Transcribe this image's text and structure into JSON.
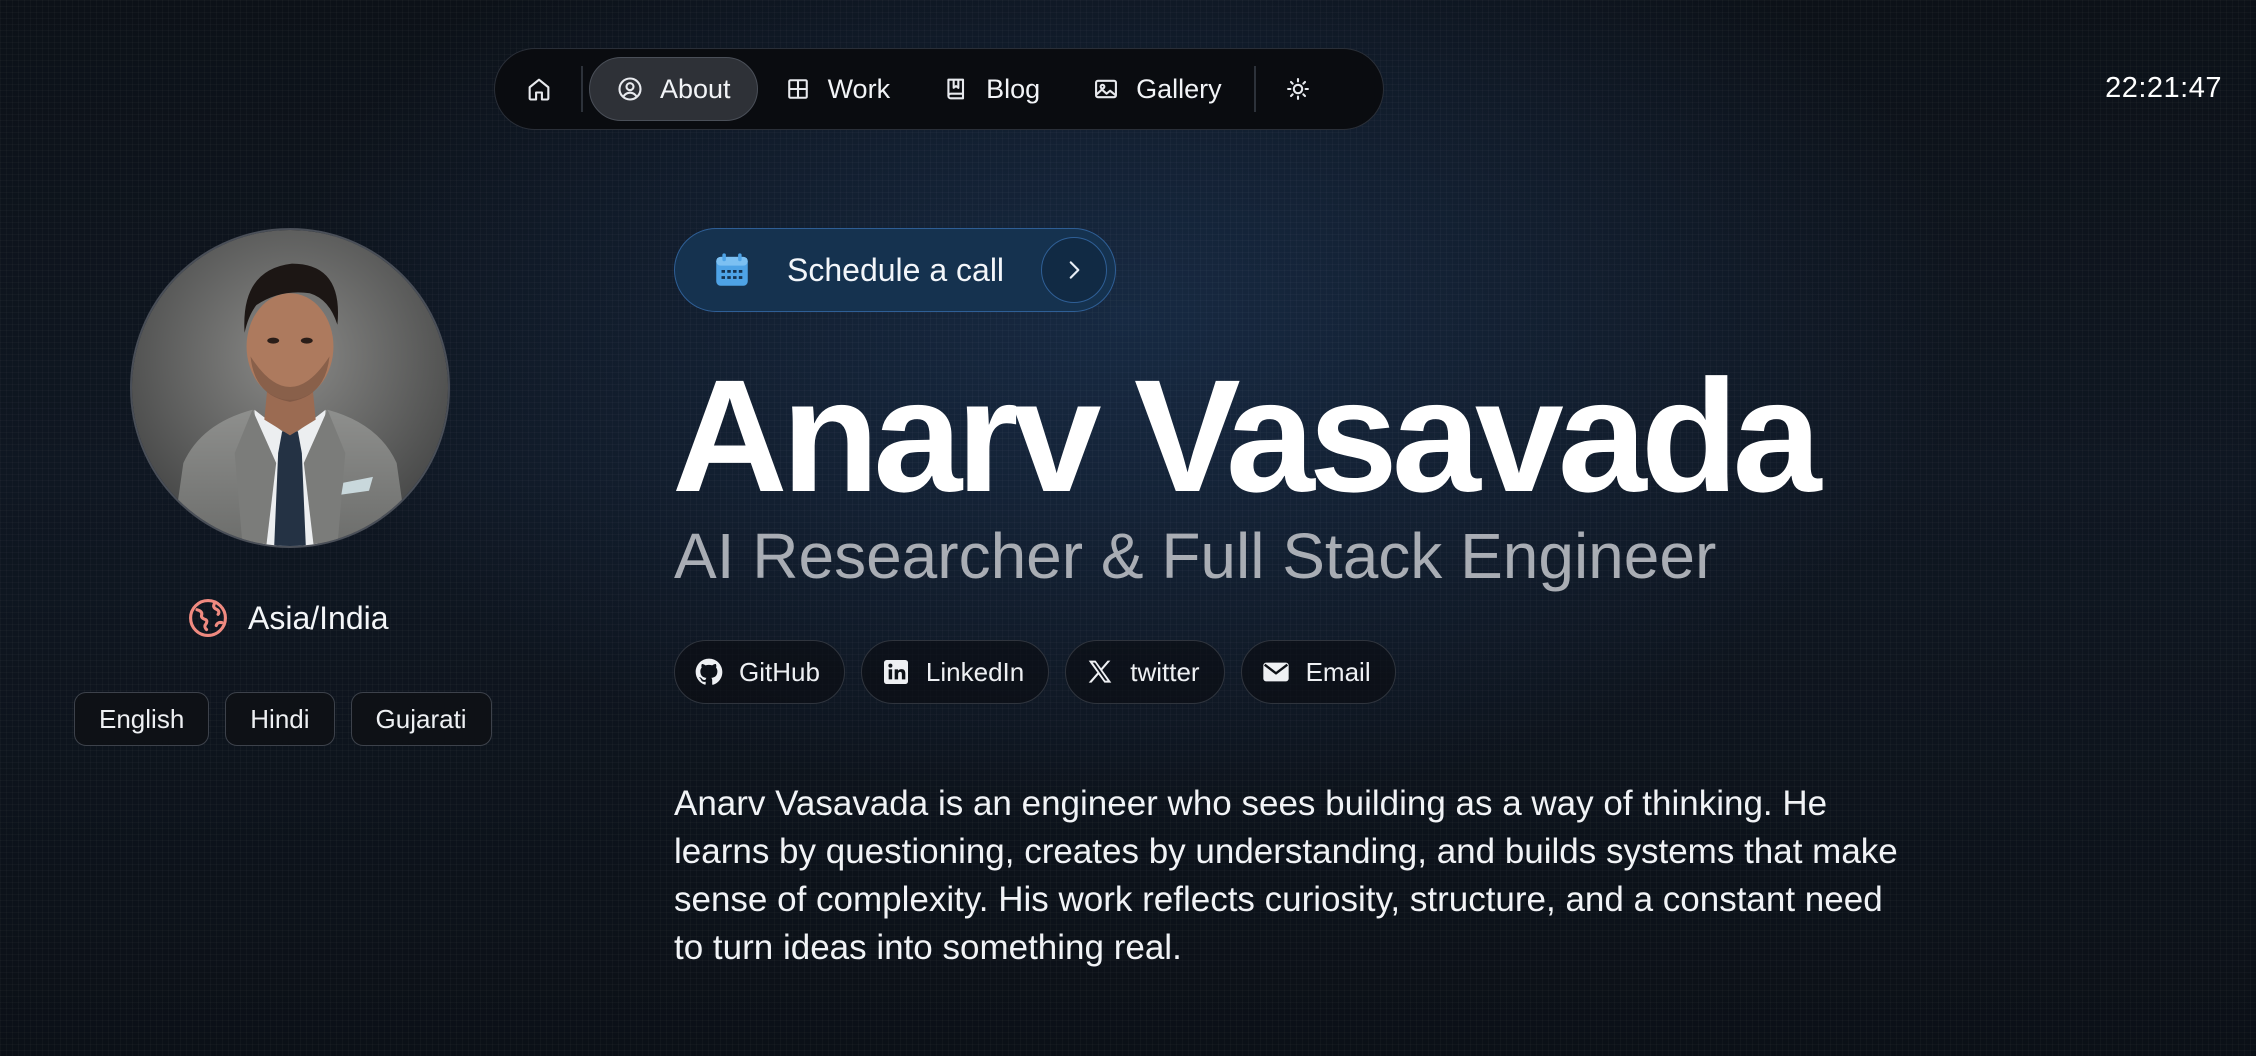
{
  "nav": {
    "home_icon": "home-icon",
    "items": [
      {
        "label": "About",
        "icon": "user-circle-icon",
        "active": true
      },
      {
        "label": "Work",
        "icon": "grid-icon",
        "active": false
      },
      {
        "label": "Blog",
        "icon": "book-icon",
        "active": false
      },
      {
        "label": "Gallery",
        "icon": "image-icon",
        "active": false
      }
    ],
    "theme_icon": "sun-icon"
  },
  "clock": "22:21:47",
  "profile": {
    "location": "Asia/India",
    "location_icon": "globe-icon",
    "languages": [
      "English",
      "Hindi",
      "Gujarati"
    ]
  },
  "cta": {
    "label": "Schedule a call",
    "icon": "calendar-icon",
    "arrow_icon": "chevron-right-icon"
  },
  "hero": {
    "name": "Anarv Vasavada",
    "role": "AI Researcher & Full Stack Engineer"
  },
  "socials": [
    {
      "label": "GitHub",
      "icon": "github-icon"
    },
    {
      "label": "LinkedIn",
      "icon": "linkedin-icon"
    },
    {
      "label": "twitter",
      "icon": "x-icon"
    },
    {
      "label": "Email",
      "icon": "mail-icon"
    }
  ],
  "bio": "Anarv Vasavada is an engineer who sees building as a way of thinking. He learns by questioning, creates by understanding, and builds systems that make sense of complexity. His work reflects curiosity, structure, and a constant need to turn ideas into something real.",
  "colors": {
    "background": "#0f1722",
    "accent": "#15324f",
    "accent_border": "#2f5f96",
    "muted_text": "#a9adb4",
    "location_icon": "#f08a80"
  }
}
